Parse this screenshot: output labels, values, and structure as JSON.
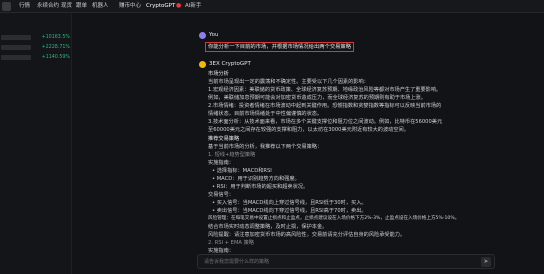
{
  "nav": {
    "items": [
      "行情",
      "永续合约",
      "现货",
      "跟单",
      "机器人",
      "赚币中心"
    ],
    "gpt_label": "CryptoGPT",
    "ai_label": "AI新手"
  },
  "tickers": [
    {
      "change": "+10163.5%"
    },
    {
      "change": "+2228.71%"
    },
    {
      "change": "+1140.59%"
    }
  ],
  "chat": {
    "user_name": "You",
    "user_message": "你能分析一下目前的市场，并根据市场情况给出两个交易策略",
    "bot_name": "3EX CryptoGPT",
    "answer": {
      "p1_title": "市场分析",
      "p1_lines": [
        "当前市场呈现出一定的震荡和不确定性。主要受以下几个因素的影响：",
        "1.宏观经济因素：美联储的货币政策、全球经济复苏预期、地缘政治风险等都对市场产生了重要影响。",
        "例如，美联储加息预期可能会对加密货币造成压力，而全球经济复苏的预期则有助于市场上涨。",
        "2.市场情绪：投资者情绪在市场波动中起到关键作用。恐慌指数和贪婪指数等指标可以反映当前市场的",
        "情绪状态，目前市场情绪处于中性偏谨慎的状态。",
        "3.技术面分析：从技术面来看，市场在多个关键支撑位和阻力位之间波动。例如，比特币在56000美元",
        "至60000美元之间存在较强的支撑和阻力，以太坊在3000美元附近有较大的波动空间。"
      ],
      "p2_title": "推荐交易策略",
      "p2_intro": "基于当前市场的分析，我推荐以下两个交易策略：",
      "s1_title": "1. 短线+趋势型策略",
      "s1_lines": [
        "实施指南：",
        "• 选择指标：MACD和RSI",
        "• MACD：用于识别趋势方向和强度。",
        "• RSI：用于判断市场的超买和超卖状况。",
        "交易信号：",
        "• 买入信号：当MACD线向上穿过信号线，且RSI低于30时，买入。",
        "• 卖出信号：当MACD线向下穿过信号线，且RSI高于70时，卖出。",
        "风险管理：在每笔交易中设置止损点和止盈点，止损点建议设在入场价格下方2%-3%，止盈点设在入场价格上方5%-10%。",
        "结合市场实时动态调整策略，及时止损，保护本金。",
        "风险提醒：请注意加密货币市场的高风险性，交易前请充分评估自身的风险承受能力。"
      ],
      "s2_title": "2. RSI + EMA 策略",
      "s2_lines": [
        "实施指南："
      ]
    }
  },
  "input": {
    "placeholder": "请告诉我您需要什么样的策略"
  }
}
